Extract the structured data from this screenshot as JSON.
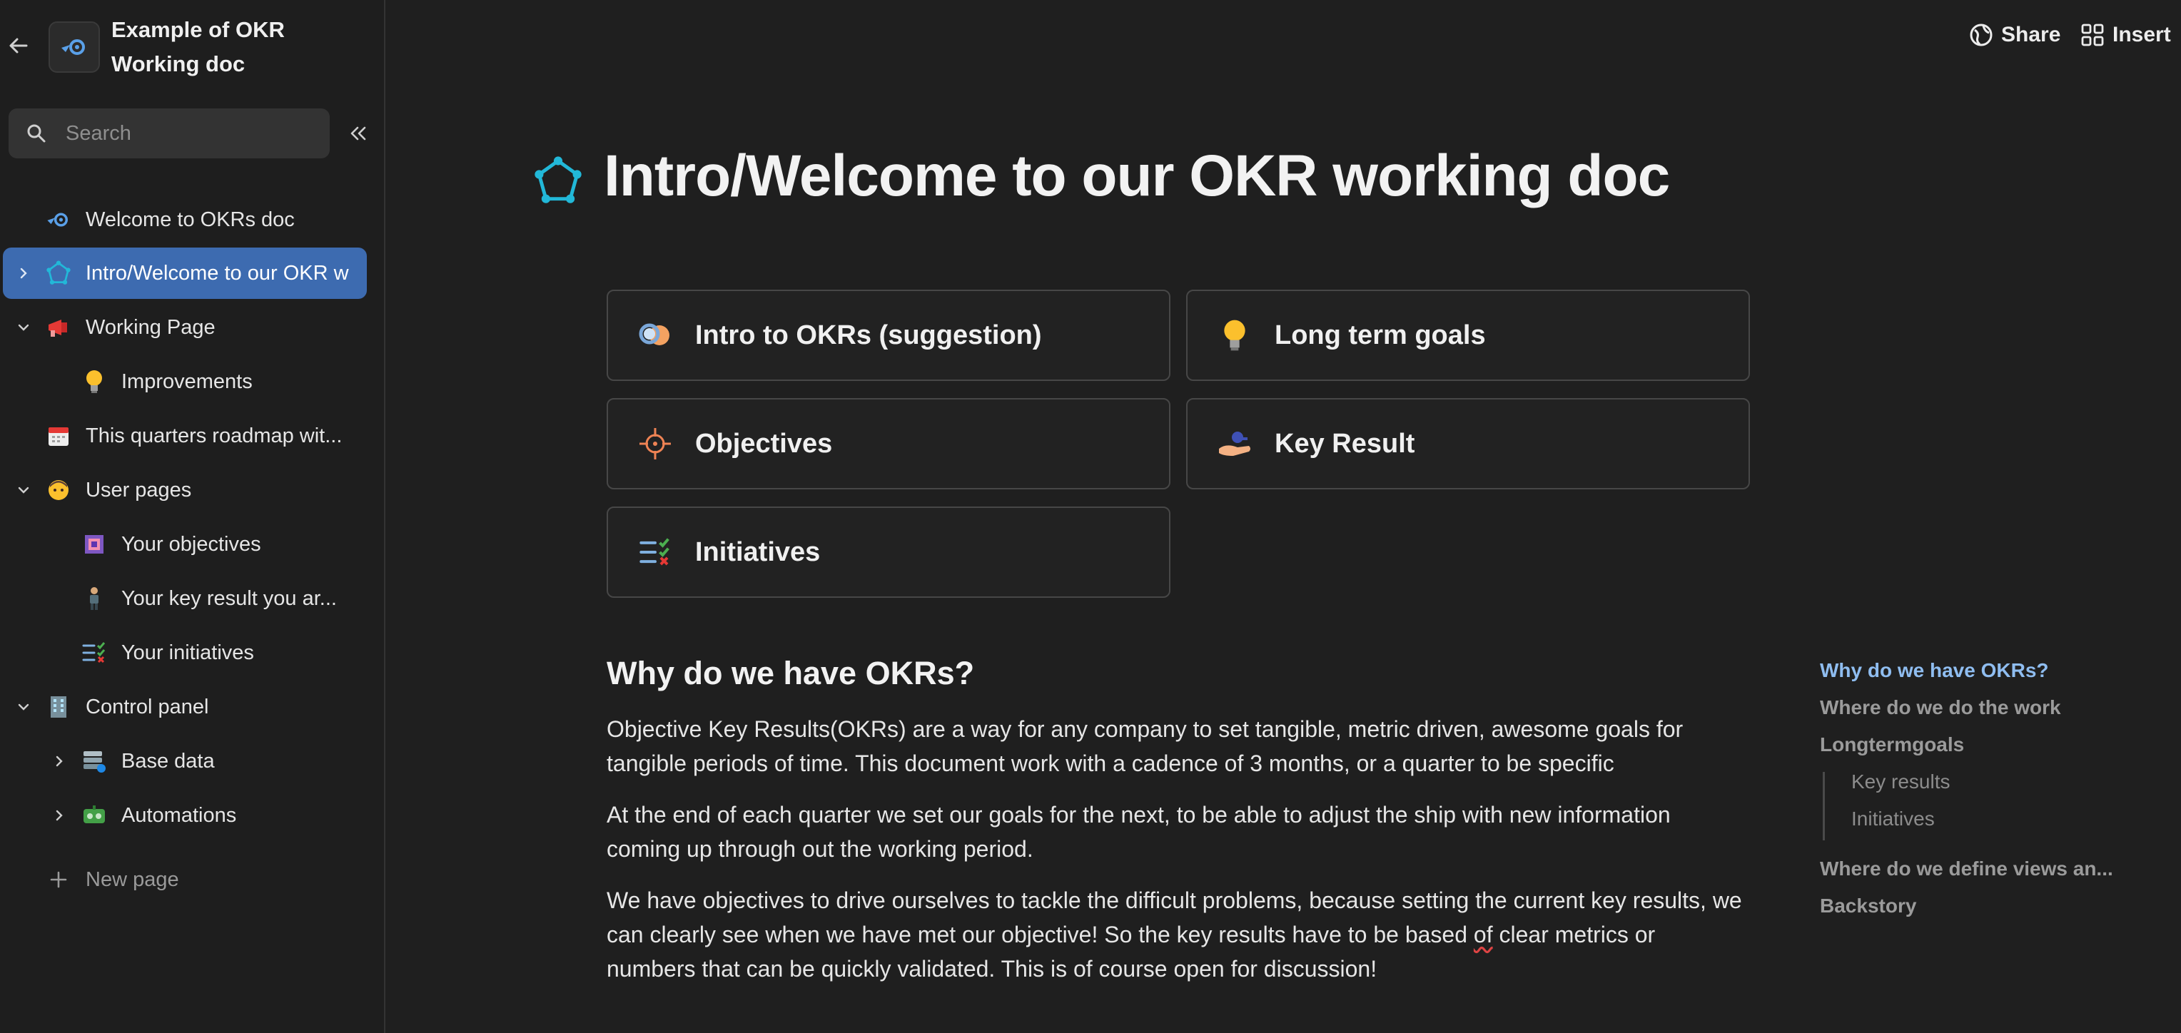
{
  "sidebar": {
    "doc_title_line1": "Example of OKR",
    "doc_title_line2": "Working doc",
    "search_placeholder": "Search",
    "items": [
      {
        "label": "Welcome to OKRs doc",
        "icon": "okr-logo-icon"
      },
      {
        "label": "Intro/Welcome to our OKR w",
        "icon": "pentagon-nodes-icon",
        "active": true
      },
      {
        "label": "Working Page",
        "icon": "megaphone-icon"
      },
      {
        "label": "Improvements",
        "icon": "lightbulb-icon"
      },
      {
        "label": "This quarters roadmap wit...",
        "icon": "calendar-icon"
      },
      {
        "label": "User pages",
        "icon": "person-icon"
      },
      {
        "label": "Your objectives",
        "icon": "framed-picture-icon"
      },
      {
        "label": "Your key result you ar...",
        "icon": "person-standing-icon"
      },
      {
        "label": "Your initiatives",
        "icon": "checklist-icon"
      },
      {
        "label": "Control panel",
        "icon": "building-icon"
      },
      {
        "label": "Base data",
        "icon": "database-icon"
      },
      {
        "label": "Automations",
        "icon": "robot-icon"
      },
      {
        "label": "New page",
        "icon": "plus-icon"
      }
    ]
  },
  "topbar": {
    "share_label": "Share",
    "insert_label": "Insert"
  },
  "main": {
    "title": "Intro/Welcome to our OKR working doc",
    "cards": [
      {
        "label": "Intro to OKRs (suggestion)",
        "icon": "magnifier-person-icon"
      },
      {
        "label": "Long term goals",
        "icon": "lightbulb-icon"
      },
      {
        "label": "Objectives",
        "icon": "crosshair-icon"
      },
      {
        "label": "Key Result",
        "icon": "hand-key-icon"
      },
      {
        "label": "Initiatives",
        "icon": "checklist-icon"
      }
    ],
    "section_heading": "Why do we have OKRs?",
    "paragraphs": [
      "Objective Key Results(OKRs) are a way for any company to set tangible, metric driven, awesome goals for tangible periods of time. This document work with a cadence of 3 months,  or a quarter to be specific",
      "At the end of each quarter we set our goals for the next, to be able to adjust the ship with new information coming up through out the working period."
    ],
    "paragraph3_before": "We have objectives to drive ourselves to tackle the difficult problems, because setting the current key results, we can clearly see when we have met our objective! So the key results have to be based ",
    "paragraph3_squiggle": "of",
    "paragraph3_after": " clear metrics or numbers that can be quickly validated. This is of course open for discussion!"
  },
  "toc": {
    "items": [
      "Why do we have OKRs?",
      "Where do we do the work",
      "Longtermgoals",
      "Key results",
      "Initiatives",
      "Where do we define views an...",
      "Backstory"
    ]
  },
  "colors": {
    "background": "#1f1f1f",
    "active_nav": "#3d6bb0",
    "toc_active": "#8fbdf0",
    "accent_teal": "#22b8d8"
  }
}
